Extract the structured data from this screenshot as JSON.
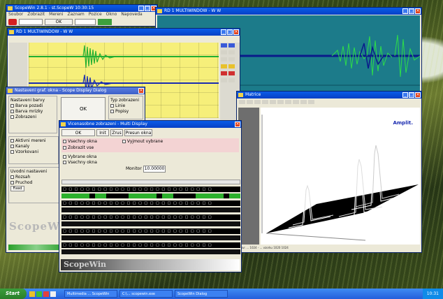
{
  "win_main": {
    "title": "ScopeWin 2.8.1 - st.ScopeW 10:30:15",
    "menu": [
      "Soubor",
      "Zobrazit",
      "Mereni",
      "Zaznam",
      "Pozice",
      "Okno",
      "Napoveda"
    ],
    "btn_ok": "OK"
  },
  "win_wide": {
    "title": "RD 1 MULTIWINDOW - W W"
  },
  "win_scope": {
    "title": "RD 1 MULTIWINDOW - W W"
  },
  "win_3d": {
    "title": "Matrice",
    "chart_label": "Amplit.",
    "status": "Stav: ... 1024 - ... vzorku 1020 1024"
  },
  "dlg_scope": {
    "title": "Nastaveni graf. okna - Scope Display Dialog",
    "btn_ok": "OK",
    "brand": "ScopeWin",
    "labels": [
      "Nastaveni barvy",
      "Barva pozadi",
      "Barva mrizky",
      "Zobrazeni",
      "Linie",
      "Popisy",
      "Typ zobrazeni",
      "Uvodni nastaveni",
      "Aktivni mereni",
      "Kanaly",
      "Vzorkovani",
      "Rozsah",
      "Pruchod"
    ],
    "value": "Fixed"
  },
  "dlg_multi": {
    "title": "Vicenasobne zobrazeni - Multi Display",
    "buttons": [
      "OK",
      "Init",
      "Zrus",
      "Presun okna"
    ],
    "opt1": "Vsechny okna",
    "opt2": "Vyjmout vybrane",
    "opt3": "Vybrane okna",
    "opt4": "Zobrazit vse",
    "monitor_label": "Monitor",
    "monitor_value": "10.00000",
    "brand": "ScopeWin"
  },
  "taskbar": {
    "start": "Start",
    "items": [
      "Multimedia ... ScopeWin",
      "C:\\... scopewin.exe",
      "ScopeWin Dialog"
    ],
    "clock": "10:31"
  }
}
